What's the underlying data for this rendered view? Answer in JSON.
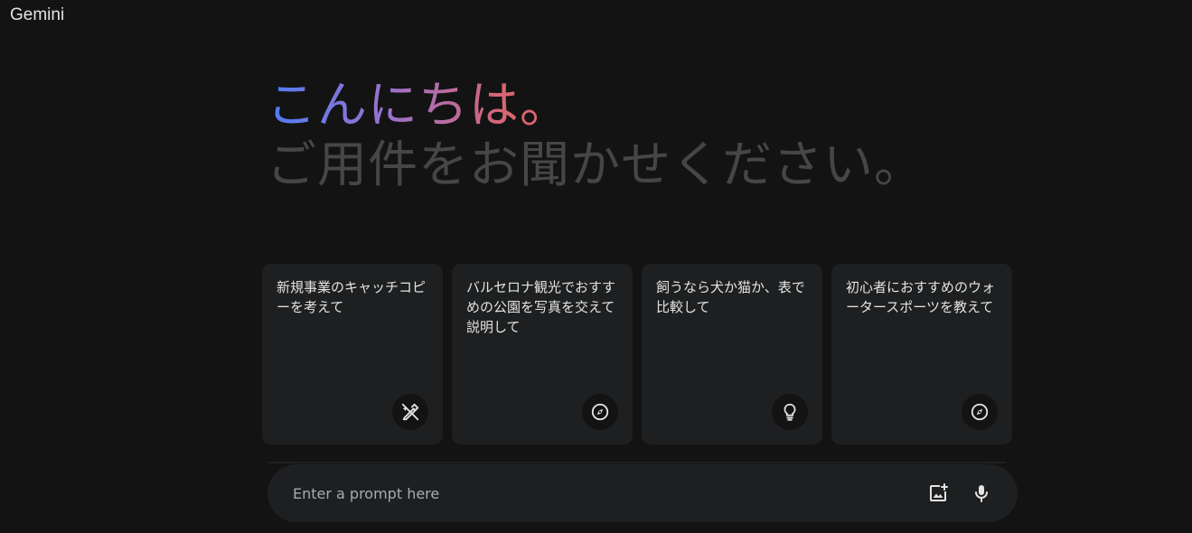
{
  "app": {
    "brand": "Gemini"
  },
  "hero": {
    "greeting": "こんにちは。",
    "subtitle": "ご用件をお聞かせください。"
  },
  "cards": [
    {
      "text": "新規事業のキャッチコピーを考えて",
      "icon": "pen-sparkle-icon"
    },
    {
      "text": "バルセロナ観光でおすすめの公園を写真を交えて説明して",
      "icon": "compass-icon"
    },
    {
      "text": "飼うなら犬か猫か、表で比較して",
      "icon": "lightbulb-icon"
    },
    {
      "text": "初心者におすすめのウォータースポーツを教えて",
      "icon": "compass-icon"
    }
  ],
  "prompt": {
    "placeholder": "Enter a prompt here",
    "value": "",
    "image_button_icon": "add-image-icon",
    "mic_button_icon": "microphone-icon"
  },
  "colors": {
    "background": "#131314",
    "card": "#1e1f20",
    "text": "#e3e3e3",
    "subtitle": "#444746",
    "gradient_start": "#4f7cf4",
    "gradient_mid": "#9b72cb",
    "gradient_end": "#d96570"
  }
}
